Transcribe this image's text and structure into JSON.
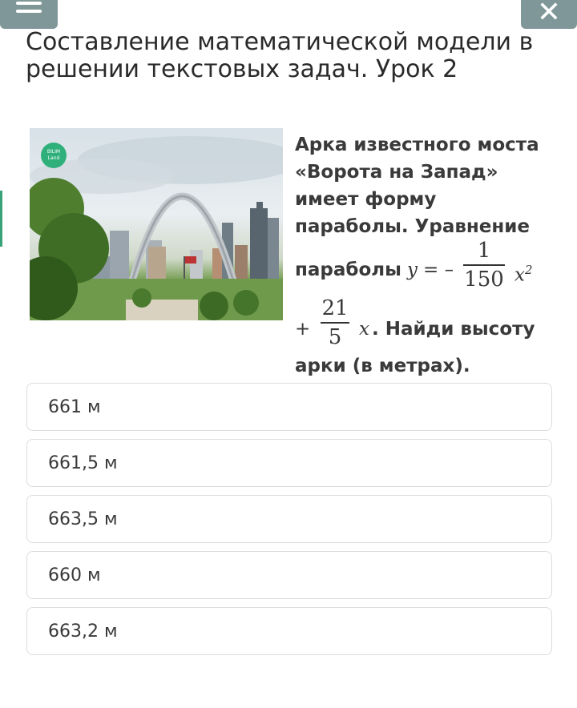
{
  "header": {
    "title": "Составление математической модели в решении текстовых задач. Урок 2",
    "close_symbol": "✕"
  },
  "image": {
    "logo_text_1": "BILIM",
    "logo_text_2": "Land"
  },
  "question": {
    "line1": "Арка известного моста «Ворота на Запад» имеет форму параболы. Уравнение",
    "parabola_word": "параболы",
    "y_var": "y",
    "eq_sign": "= –",
    "frac1_num": "1",
    "frac1_den": "150",
    "x_sq": "x",
    "sq_exp": "2",
    "plus": "+",
    "frac2_num": "21",
    "frac2_den": "5",
    "x_var": "x",
    "tail": ". Найди высоту",
    "line_last": "арки (в метрах)."
  },
  "answers": [
    {
      "label": "661 м"
    },
    {
      "label": "661,5 м"
    },
    {
      "label": "663,5 м"
    },
    {
      "label": "660 м"
    },
    {
      "label": "663,2 м"
    }
  ],
  "colors": {
    "header_button": "#7f9799",
    "accent_green": "#3aa27a",
    "option_border": "#d9dde0"
  }
}
